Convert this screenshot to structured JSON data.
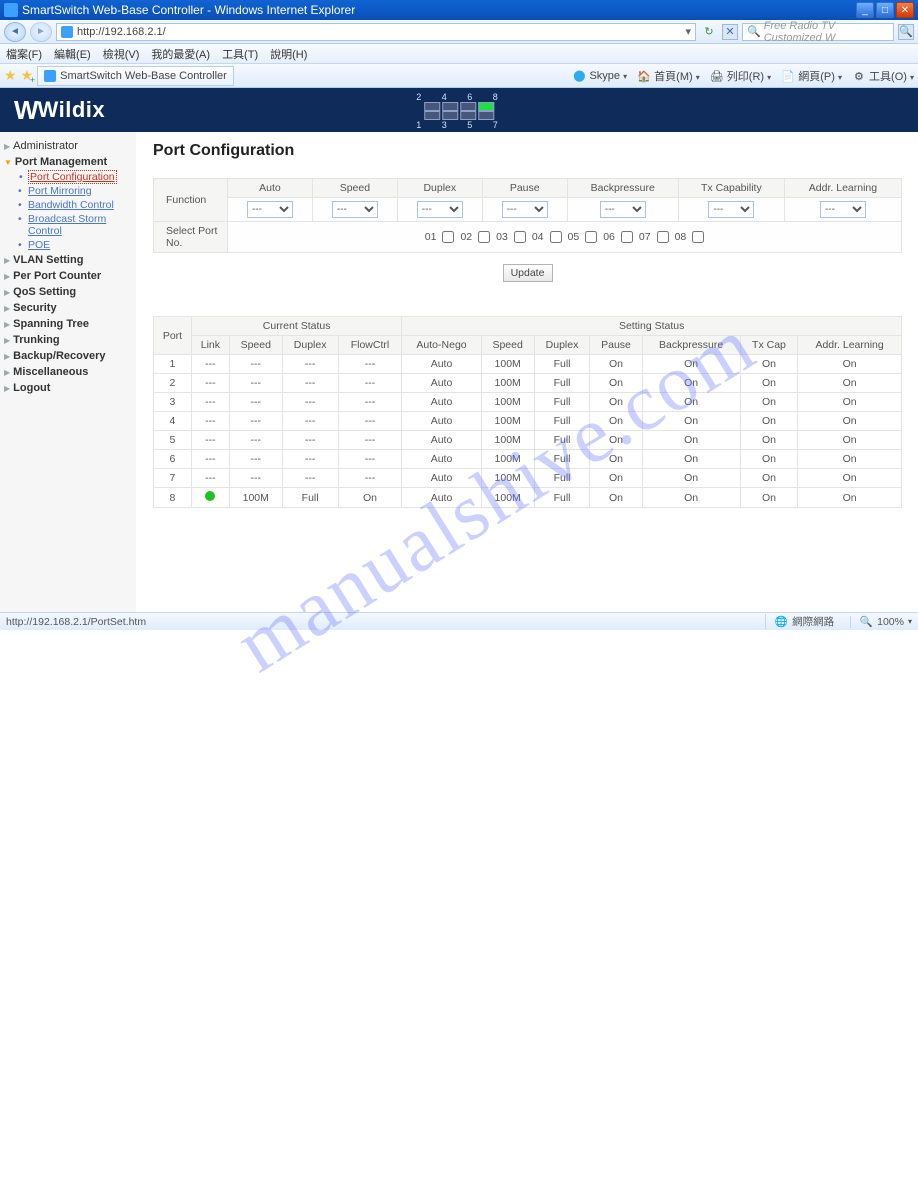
{
  "window": {
    "title": "SmartSwitch Web-Base Controller - Windows Internet Explorer"
  },
  "address": {
    "url": "http://192.168.2.1/"
  },
  "search": {
    "placeholder": "Free Radio TV Customized W"
  },
  "menu": {
    "file": "檔案(F)",
    "edit": "編輯(E)",
    "view": "檢視(V)",
    "fav": "我的最愛(A)",
    "tools": "工具(T)",
    "help": "說明(H)"
  },
  "tab": {
    "title": "SmartSwitch Web-Base Controller"
  },
  "toolbar": {
    "skype": "Skype",
    "home": "首頁(M)",
    "print": "列印(R)",
    "page": "網頁(P)",
    "tools": "工具(O)"
  },
  "logo": {
    "text": "Wildix"
  },
  "portnums": {
    "top": "2 4 6 8",
    "bottom": "1 3 5 7"
  },
  "sidebar": {
    "administrator": "Administrator",
    "port_mgmt": "Port Management",
    "items": {
      "port_config": "Port Configuration",
      "port_mirror": "Port Mirroring",
      "bw": "Bandwidth Control",
      "storm": "Broadcast Storm Control",
      "poe": "POE"
    },
    "vlan": "VLAN Setting",
    "ppc": "Per Port Counter",
    "qos": "QoS Setting",
    "sec": "Security",
    "stp": "Spanning Tree",
    "trunk": "Trunking",
    "backup": "Backup/Recovery",
    "misc": "Miscellaneous",
    "logout": "Logout"
  },
  "page": {
    "title": "Port Configuration"
  },
  "cfg": {
    "function": "Function",
    "select_port": "Select Port No.",
    "cols": {
      "auto": "Auto",
      "speed": "Speed",
      "duplex": "Duplex",
      "pause": "Pause",
      "bp": "Backpressure",
      "txcap": "Tx Capability",
      "addr": "Addr. Learning"
    },
    "opt": "---",
    "ports": [
      "01",
      "02",
      "03",
      "04",
      "05",
      "06",
      "07",
      "08"
    ],
    "update": "Update"
  },
  "status": {
    "head": {
      "port": "Port",
      "current": "Current Status",
      "setting": "Setting Status",
      "link": "Link",
      "speed": "Speed",
      "duplex": "Duplex",
      "flow": "FlowCtrl",
      "auto": "Auto-Nego",
      "sspeed": "Speed",
      "sduplex": "Duplex",
      "pause": "Pause",
      "bp": "Backpressure",
      "txcap": "Tx Cap",
      "addr": "Addr. Learning"
    },
    "rows": [
      {
        "p": "1",
        "link": "---",
        "cs": "---",
        "cd": "---",
        "cf": "---",
        "a": "Auto",
        "s": "100M",
        "d": "Full",
        "pa": "On",
        "bp": "On",
        "tx": "On",
        "al": "On"
      },
      {
        "p": "2",
        "link": "---",
        "cs": "---",
        "cd": "---",
        "cf": "---",
        "a": "Auto",
        "s": "100M",
        "d": "Full",
        "pa": "On",
        "bp": "On",
        "tx": "On",
        "al": "On"
      },
      {
        "p": "3",
        "link": "---",
        "cs": "---",
        "cd": "---",
        "cf": "---",
        "a": "Auto",
        "s": "100M",
        "d": "Full",
        "pa": "On",
        "bp": "On",
        "tx": "On",
        "al": "On"
      },
      {
        "p": "4",
        "link": "---",
        "cs": "---",
        "cd": "---",
        "cf": "---",
        "a": "Auto",
        "s": "100M",
        "d": "Full",
        "pa": "On",
        "bp": "On",
        "tx": "On",
        "al": "On"
      },
      {
        "p": "5",
        "link": "---",
        "cs": "---",
        "cd": "---",
        "cf": "---",
        "a": "Auto",
        "s": "100M",
        "d": "Full",
        "pa": "On",
        "bp": "On",
        "tx": "On",
        "al": "On"
      },
      {
        "p": "6",
        "link": "---",
        "cs": "---",
        "cd": "---",
        "cf": "---",
        "a": "Auto",
        "s": "100M",
        "d": "Full",
        "pa": "On",
        "bp": "On",
        "tx": "On",
        "al": "On"
      },
      {
        "p": "7",
        "link": "---",
        "cs": "---",
        "cd": "---",
        "cf": "---",
        "a": "Auto",
        "s": "100M",
        "d": "Full",
        "pa": "On",
        "bp": "On",
        "tx": "On",
        "al": "On"
      },
      {
        "p": "8",
        "link": "up",
        "cs": "100M",
        "cd": "Full",
        "cf": "On",
        "a": "Auto",
        "s": "100M",
        "d": "Full",
        "pa": "On",
        "bp": "On",
        "tx": "On",
        "al": "On"
      }
    ]
  },
  "statusbar": {
    "left": "http://192.168.2.1/PortSet.htm",
    "net": "網際網路",
    "zoom": "100%"
  },
  "watermark": "manualshive.com"
}
